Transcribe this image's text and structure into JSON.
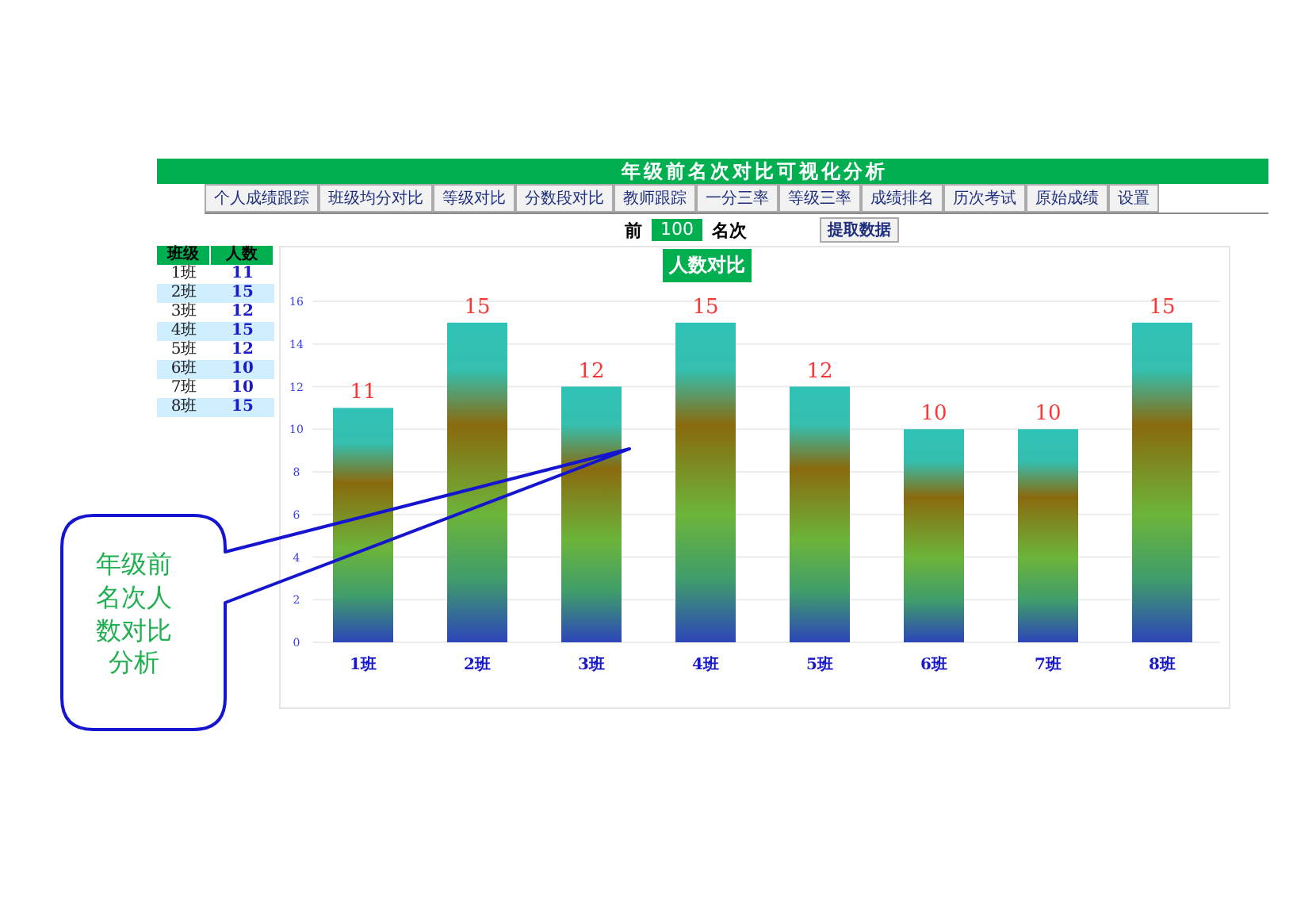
{
  "title": "年级前名次对比可视化分析",
  "nav": [
    {
      "label": "个人成绩跟踪"
    },
    {
      "label": "班级均分对比"
    },
    {
      "label": "等级对比"
    },
    {
      "label": "分数段对比"
    },
    {
      "label": "教师跟踪"
    },
    {
      "label": "一分三率"
    },
    {
      "label": "等级三率"
    },
    {
      "label": "成绩排名"
    },
    {
      "label": "历次考试"
    },
    {
      "label": "原始成绩"
    },
    {
      "label": "设置"
    }
  ],
  "filter": {
    "prefix": "前",
    "value": "100",
    "suffix": "名次",
    "button": "提取数据"
  },
  "table": {
    "columns": [
      "班级",
      "人数"
    ],
    "rows": [
      [
        "1班",
        "11"
      ],
      [
        "2班",
        "15"
      ],
      [
        "3班",
        "12"
      ],
      [
        "4班",
        "15"
      ],
      [
        "5班",
        "12"
      ],
      [
        "6班",
        "10"
      ],
      [
        "7班",
        "10"
      ],
      [
        "8班",
        "15"
      ]
    ]
  },
  "chart_data": {
    "type": "bar",
    "title": "人数对比",
    "categories": [
      "1班",
      "2班",
      "3班",
      "4班",
      "5班",
      "6班",
      "7班",
      "8班"
    ],
    "values": [
      11,
      15,
      12,
      15,
      12,
      10,
      10,
      15
    ],
    "ylim": [
      0,
      16
    ],
    "yticks": [
      0,
      2,
      4,
      6,
      8,
      10,
      12,
      14,
      16
    ],
    "data_labels": true,
    "grid": true
  },
  "callout": {
    "text": "年级前名次人数对比分析"
  }
}
